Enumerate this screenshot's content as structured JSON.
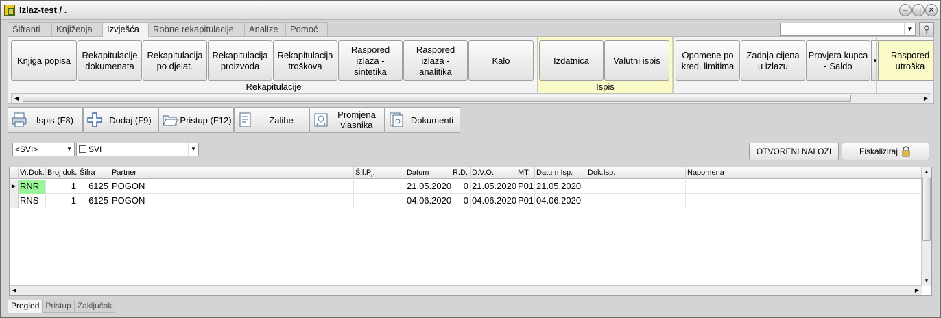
{
  "window": {
    "title": "Izlaz-test / ."
  },
  "window_controls": {
    "minimize": "–",
    "restore": "□",
    "close": "✕"
  },
  "ribbon_tabs": [
    "Šifranti",
    "Knjiženja",
    "Izvješća",
    "Robne rekapitulacije",
    "Analize",
    "Pomoć"
  ],
  "ribbon_active_tab": "Izvješća",
  "search": {
    "value": "",
    "placeholder": ""
  },
  "ribbon": {
    "buttons": [
      "Knjiga popisa",
      "Rekapitulacije dokumenata",
      "Rekapitulacija po djelat.",
      "Rekapitulacija proizvoda",
      "Rekapitulacija troškova",
      "Raspored izlaza - sintetika",
      "Raspored izlaza - analitika",
      "Kalo",
      "Izdatnica",
      "Valutni ispis",
      "Opomene po kred. limitima",
      "Zadnja cijena u izlazu",
      "Provjera kupca - Saldo",
      "Raspored utroška"
    ],
    "groups": [
      "Rekapitulacije",
      "Ispis"
    ]
  },
  "toolbar": {
    "buttons": [
      {
        "label": "Ispis (F8)",
        "icon": "printer-icon"
      },
      {
        "label": "Dodaj (F9)",
        "icon": "add-icon"
      },
      {
        "label": "Pristup (F12)",
        "icon": "folder-icon"
      },
      {
        "label": "Zalihe",
        "icon": "document-list-icon"
      },
      {
        "label": "Promjena vlasnika",
        "icon": "owner-change-icon"
      },
      {
        "label": "Dokumenti",
        "icon": "documents-icon"
      }
    ]
  },
  "filters": {
    "combo1": "<SVI>",
    "combo2": "SVI",
    "open_orders_button": "OTVORENI NALOZI",
    "fiscalize_button": "Fiskaliziraj"
  },
  "grid": {
    "columns": [
      "Vr.Dok.",
      "Broj dok.",
      "Šifra",
      "Partner",
      "Šif.Pj.",
      "Datum",
      "R.D.",
      "D.V.O.",
      "MT",
      "Datum Isp.",
      "Dok.Isp.",
      "Napomena"
    ],
    "rows": [
      [
        "RNR",
        "1",
        "6125",
        "POGON",
        "",
        "21.05.2020",
        "0",
        "21.05.2020",
        "P01",
        "21.05.2020",
        "",
        ""
      ],
      [
        "RNS",
        "1",
        "6125",
        "POGON",
        "",
        "04.06.2020",
        "0",
        "04.06.2020",
        "P01",
        "04.06.2020",
        "",
        ""
      ]
    ],
    "selected_cell_color": "#98f598"
  },
  "bottom_tabs": [
    "Pregled",
    "Pristup",
    "Zaključak"
  ],
  "bottom_active_tab": "Pregled"
}
